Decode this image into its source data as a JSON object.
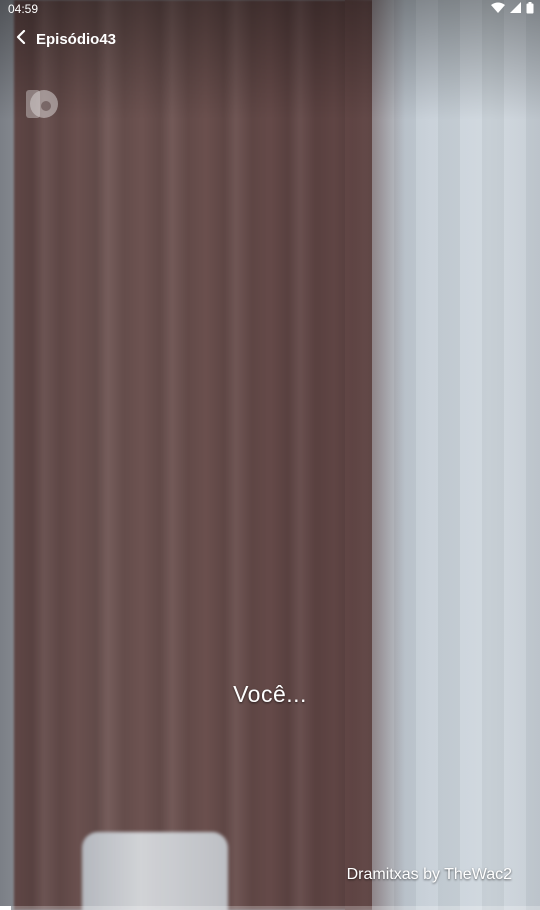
{
  "status_bar": {
    "time": "04:59",
    "icons": [
      "wifi-icon",
      "signal-icon",
      "battery-icon"
    ]
  },
  "header": {
    "back_icon": "chevron-left-icon",
    "title": "Episódio43"
  },
  "player": {
    "logo_icon": "channel-logo-icon",
    "subtitle": "Você...",
    "watermark": "Dramitxas by TheWac2",
    "progress": 0.02
  },
  "colors": {
    "text": "#ffffff",
    "curtain": "#6a4f4d",
    "window": "#c7d0d8"
  }
}
